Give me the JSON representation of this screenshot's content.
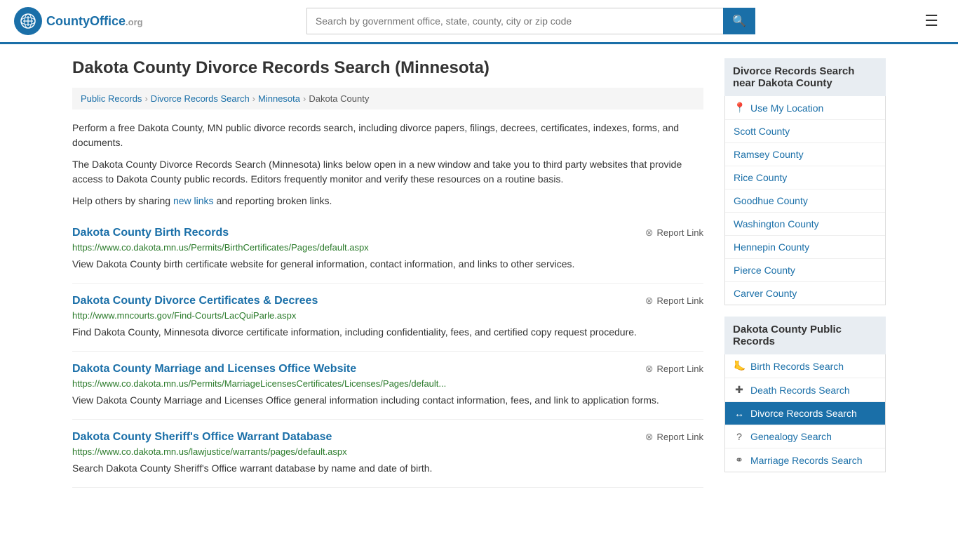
{
  "header": {
    "logo_text": "CountyOffice",
    "logo_org": ".org",
    "search_placeholder": "Search by government office, state, county, city or zip code",
    "search_value": ""
  },
  "page": {
    "title": "Dakota County Divorce Records Search (Minnesota)",
    "breadcrumb": [
      {
        "label": "Public Records",
        "href": "#"
      },
      {
        "label": "Divorce Records Search",
        "href": "#"
      },
      {
        "label": "Minnesota",
        "href": "#"
      },
      {
        "label": "Dakota County",
        "href": "#"
      }
    ],
    "description1": "Perform a free Dakota County, MN public divorce records search, including divorce papers, filings, decrees, certificates, indexes, forms, and documents.",
    "description2": "The Dakota County Divorce Records Search (Minnesota) links below open in a new window and take you to third party websites that provide access to Dakota County public records. Editors frequently monitor and verify these resources on a routine basis.",
    "description3_before": "Help others by sharing ",
    "description3_link": "new links",
    "description3_after": " and reporting broken links."
  },
  "results": [
    {
      "title": "Dakota County Birth Records",
      "url": "https://www.co.dakota.mn.us/Permits/BirthCertificates/Pages/default.aspx",
      "desc": "View Dakota County birth certificate website for general information, contact information, and links to other services.",
      "report_label": "Report Link"
    },
    {
      "title": "Dakota County Divorce Certificates & Decrees",
      "url": "http://www.mncourts.gov/Find-Courts/LacQuiParle.aspx",
      "desc": "Find Dakota County, Minnesota divorce certificate information, including confidentiality, fees, and certified copy request procedure.",
      "report_label": "Report Link"
    },
    {
      "title": "Dakota County Marriage and Licenses Office Website",
      "url": "https://www.co.dakota.mn.us/Permits/MarriageLicensesCertificates/Licenses/Pages/default...",
      "desc": "View Dakota County Marriage and Licenses Office general information including contact information, fees, and link to application forms.",
      "report_label": "Report Link"
    },
    {
      "title": "Dakota County Sheriff's Office Warrant Database",
      "url": "https://www.co.dakota.mn.us/lawjustice/warrants/pages/default.aspx",
      "desc": "Search Dakota County Sheriff's Office warrant database by name and date of birth.",
      "report_label": "Report Link"
    }
  ],
  "sidebar": {
    "nearby_header": "Divorce Records Search near Dakota County",
    "use_my_location": "Use My Location",
    "nearby_counties": [
      "Scott County",
      "Ramsey County",
      "Rice County",
      "Goodhue County",
      "Washington County",
      "Hennepin County",
      "Pierce County",
      "Carver County"
    ],
    "public_records_header": "Dakota County Public Records",
    "public_records_links": [
      {
        "label": "Birth Records Search",
        "icon": "🦶",
        "active": false
      },
      {
        "label": "Death Records Search",
        "icon": "✚",
        "active": false
      },
      {
        "label": "Divorce Records Search",
        "icon": "↔",
        "active": true
      },
      {
        "label": "Genealogy Search",
        "icon": "?",
        "active": false
      },
      {
        "label": "Marriage Records Search",
        "icon": "⚭",
        "active": false
      }
    ]
  }
}
